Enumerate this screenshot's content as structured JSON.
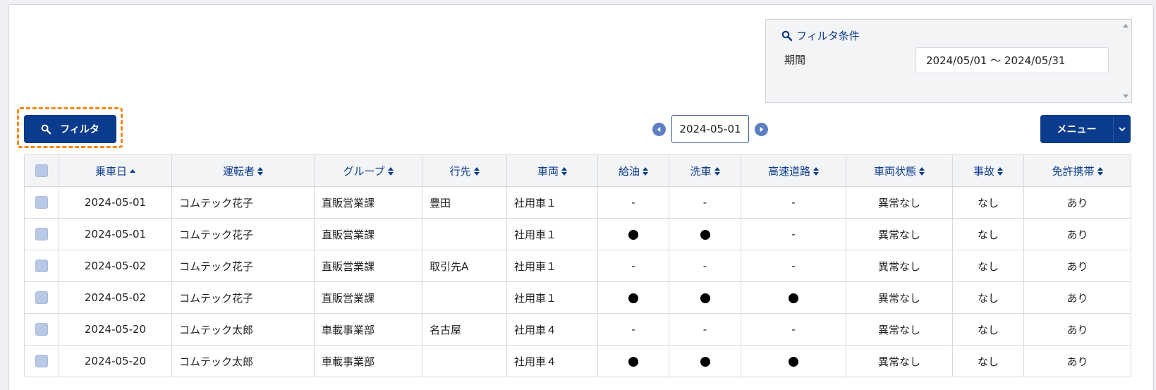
{
  "filter_panel": {
    "title": "フィルタ条件",
    "period_label": "期間",
    "period_value": "2024/05/01 〜 2024/05/31"
  },
  "toolbar": {
    "filter_button_label": "フィルタ",
    "current_date": "2024-05-01",
    "menu_label": "メニュー"
  },
  "table": {
    "columns": [
      "乗車日",
      "運転者",
      "グループ",
      "行先",
      "車両",
      "給油",
      "洗車",
      "高速道路",
      "車両状態",
      "事故",
      "免許携帯"
    ],
    "rows": [
      {
        "date": "2024-05-01",
        "driver": "コムテック花子",
        "group": "直販営業課",
        "destination": "豊田",
        "vehicle": "社用車１",
        "fuel": "-",
        "wash": "-",
        "highway": "-",
        "condition": "異常なし",
        "accident": "なし",
        "license": "あり"
      },
      {
        "date": "2024-05-01",
        "driver": "コムテック花子",
        "group": "直販営業課",
        "destination": "",
        "vehicle": "社用車１",
        "fuel": "●",
        "wash": "●",
        "highway": "-",
        "condition": "異常なし",
        "accident": "なし",
        "license": "あり"
      },
      {
        "date": "2024-05-02",
        "driver": "コムテック花子",
        "group": "直販営業課",
        "destination": "取引先A",
        "vehicle": "社用車１",
        "fuel": "-",
        "wash": "-",
        "highway": "-",
        "condition": "異常なし",
        "accident": "なし",
        "license": "あり"
      },
      {
        "date": "2024-05-02",
        "driver": "コムテック花子",
        "group": "直販営業課",
        "destination": "",
        "vehicle": "社用車１",
        "fuel": "●",
        "wash": "●",
        "highway": "●",
        "condition": "異常なし",
        "accident": "なし",
        "license": "あり"
      },
      {
        "date": "2024-05-20",
        "driver": "コムテック太郎",
        "group": "車載事業部",
        "destination": "名古屋",
        "vehicle": "社用車４",
        "fuel": "-",
        "wash": "-",
        "highway": "-",
        "condition": "異常なし",
        "accident": "なし",
        "license": "あり"
      },
      {
        "date": "2024-05-20",
        "driver": "コムテック太郎",
        "group": "車載事業部",
        "destination": "",
        "vehicle": "社用車４",
        "fuel": "●",
        "wash": "●",
        "highway": "●",
        "condition": "異常なし",
        "accident": "なし",
        "license": "あり"
      }
    ]
  },
  "colors": {
    "primary": "#0b3b8c",
    "highlight": "#f08a1c",
    "checkbox": "#b9c8e6"
  }
}
